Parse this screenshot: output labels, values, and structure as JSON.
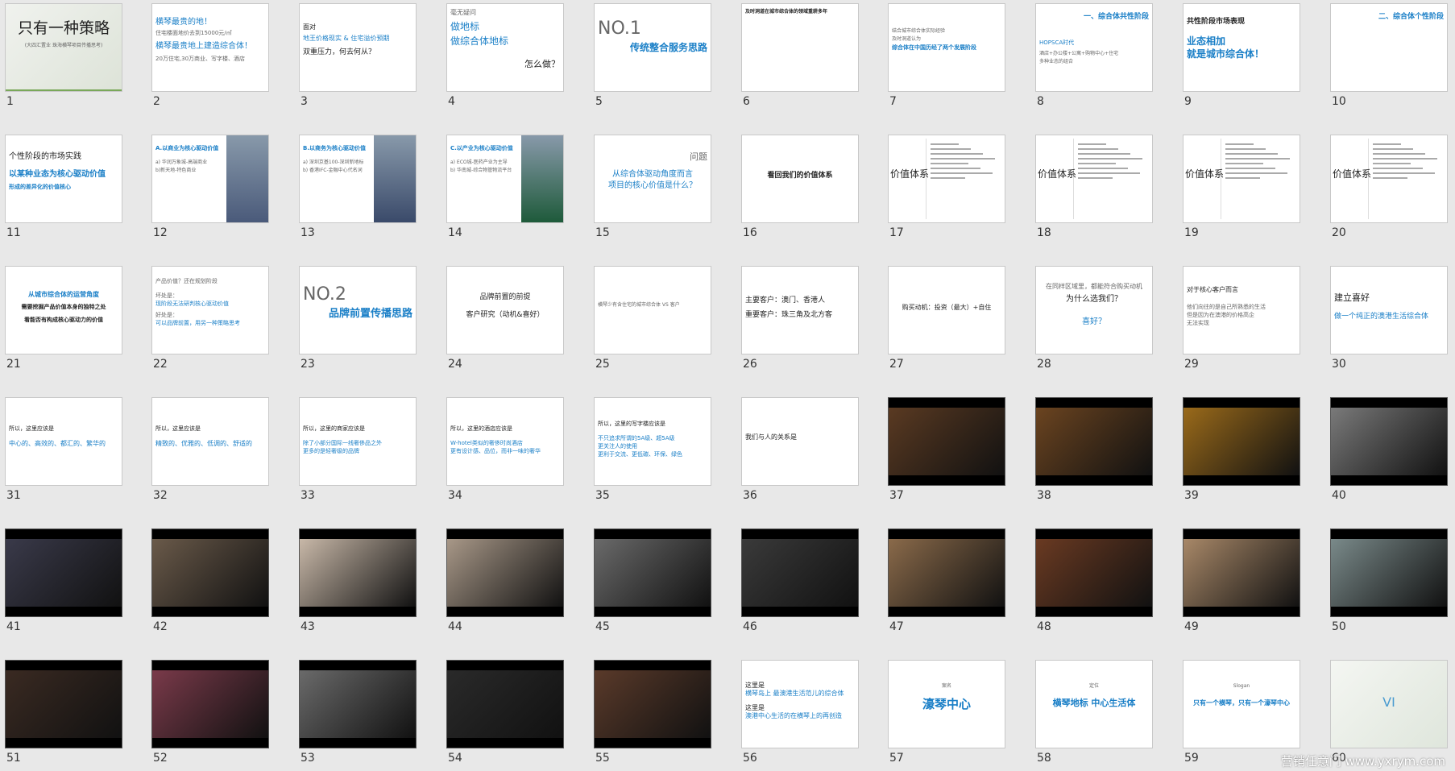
{
  "colors": {
    "accent": "#1a7fc7",
    "background": "#e8e8e8"
  },
  "slides": [
    {
      "n": "1",
      "kind": "title",
      "lines": [
        "只有一种策略",
        "(大四汇置业 珠海横琴项目传播思考)"
      ]
    },
    {
      "n": "2",
      "kind": "text",
      "lines": [
        "横琴最贵的地！",
        "住宅楼面地价去到15000元/㎡",
        "横琴最贵地上建造综合体！",
        "20万住宅,30万商业、写字楼、酒店"
      ]
    },
    {
      "n": "3",
      "kind": "text",
      "lines": [
        "面对",
        "地王价格现实 & 住宅溢价预期",
        "双重压力，何去何从？"
      ]
    },
    {
      "n": "4",
      "kind": "text",
      "lines": [
        "毫无疑问",
        "做地标",
        "做综合体地标",
        "怎么做？"
      ]
    },
    {
      "n": "5",
      "kind": "text",
      "lines": [
        "NO.1",
        "传统整合服务思路"
      ]
    },
    {
      "n": "6",
      "kind": "text",
      "lines": [
        "及时洞道在城市综合体的领域重耕多年"
      ]
    },
    {
      "n": "7",
      "kind": "text",
      "lines": [
        "结合城市综合体实际经验",
        "及时洞道认为",
        "综合体在中国历经了两个发展阶段"
      ]
    },
    {
      "n": "8",
      "kind": "text",
      "lines": [
        "一、综合体共性阶段",
        "HOPSCA时代",
        "酒店+办公楼+公寓+购物中心+住宅",
        "多种业态的组合"
      ]
    },
    {
      "n": "9",
      "kind": "text",
      "lines": [
        "共性阶段市场表现",
        "业态相加",
        "就是城市综合体！"
      ]
    },
    {
      "n": "10",
      "kind": "text",
      "lines": [
        "二、综合体个性阶段"
      ]
    },
    {
      "n": "11",
      "kind": "text",
      "lines": [
        "个性阶段的市场实践",
        "以某种业态为核心驱动价值",
        "形成的差异化的价值核心"
      ]
    },
    {
      "n": "12",
      "kind": "side",
      "lines": [
        "A.以商业为核心驱动价值",
        "a) 华润万象城-高端商业",
        "b)新天地-特色商业"
      ]
    },
    {
      "n": "13",
      "kind": "side",
      "lines": [
        "B.以商务为核心驱动价值",
        "a) 深圳京基100-深圳新地标",
        "b) 香港IFC-金融中心代名词"
      ]
    },
    {
      "n": "14",
      "kind": "side",
      "lines": [
        "C.以产业为核心驱动价值",
        "a) ECO城-医药产业为主导",
        "b) 华南城-综合物管物流平台"
      ]
    },
    {
      "n": "15",
      "kind": "text",
      "lines": [
        "问题",
        "从综合体驱动角度而言",
        "项目的核心价值是什么？"
      ]
    },
    {
      "n": "16",
      "kind": "text",
      "lines": [
        "看回我们的价值体系"
      ]
    },
    {
      "n": "17",
      "kind": "value",
      "lines": [
        "价值体系"
      ]
    },
    {
      "n": "18",
      "kind": "value",
      "lines": [
        "价值体系"
      ]
    },
    {
      "n": "19",
      "kind": "value",
      "lines": [
        "价值体系"
      ]
    },
    {
      "n": "20",
      "kind": "value",
      "lines": [
        "价值体系"
      ]
    },
    {
      "n": "21",
      "kind": "text",
      "lines": [
        "从城市综合体的运营角度",
        "需要挖掘产品价值本身的独特之处",
        "看能否有构成核心驱动力的价值"
      ]
    },
    {
      "n": "22",
      "kind": "text",
      "lines": [
        "产品价值？还在规划阶段",
        "坏处是：",
        "现阶段无法研判核心驱动价值",
        "好处是：",
        "可以品牌前置，用另一种策略思考"
      ]
    },
    {
      "n": "23",
      "kind": "text",
      "lines": [
        "NO.2",
        "品牌前置传播思路"
      ]
    },
    {
      "n": "24",
      "kind": "text",
      "lines": [
        "品牌前置的前提",
        "客户研究（动机&喜好）"
      ]
    },
    {
      "n": "25",
      "kind": "text",
      "lines": [
        "横琴少有含住宅的城市综合体  VS  客户"
      ]
    },
    {
      "n": "26",
      "kind": "text",
      "lines": [
        "主要客户：澳门、香港人",
        "重要客户：珠三角及北方客"
      ]
    },
    {
      "n": "27",
      "kind": "text",
      "lines": [
        "购买动机：投资（最大）+自住"
      ]
    },
    {
      "n": "28",
      "kind": "text",
      "lines": [
        "在同样区域里，都能符合购买动机",
        "为什么选我们？",
        "喜好？"
      ]
    },
    {
      "n": "29",
      "kind": "text",
      "lines": [
        "对于核心客户而言",
        "他们向往的是自己所熟悉的生活",
        "但是因为在澳港的价格高企",
        "无法实现"
      ]
    },
    {
      "n": "30",
      "kind": "text",
      "lines": [
        "建立喜好",
        "做一个纯正的澳港生活综合体"
      ]
    },
    {
      "n": "31",
      "kind": "text",
      "lines": [
        "所以，这里应该是",
        "中心的、高效的、都汇的、繁华的"
      ]
    },
    {
      "n": "32",
      "kind": "text",
      "lines": [
        "所以，这里应该是",
        "精致的、优雅的、低调的、舒适的"
      ]
    },
    {
      "n": "33",
      "kind": "text",
      "lines": [
        "所以，这里的商家应该是",
        "除了小部分国际一线奢侈品之外",
        "更多的是轻奢级的品牌"
      ]
    },
    {
      "n": "34",
      "kind": "text",
      "lines": [
        "所以，这里的酒店应该是",
        "W-hotel类似的奢侈时尚酒店",
        "更有设计感、品位，而非一味的奢华"
      ]
    },
    {
      "n": "35",
      "kind": "text",
      "lines": [
        "所以，这里的写字楼应该是",
        "不只追求所谓的5A级、超5A级",
        "更关注人的使用",
        "更利于交流、更低碳、环保、绿色"
      ]
    },
    {
      "n": "36",
      "kind": "text",
      "lines": [
        "我们与人的关系是"
      ]
    },
    {
      "n": "37",
      "kind": "photo",
      "tone": "#5a3a22"
    },
    {
      "n": "38",
      "kind": "photo",
      "tone": "#6b4420"
    },
    {
      "n": "39",
      "kind": "photo",
      "tone": "#9a6a1a"
    },
    {
      "n": "40",
      "kind": "photo",
      "tone": "#7a7a7a"
    },
    {
      "n": "41",
      "kind": "photo",
      "tone": "#3a3a4a"
    },
    {
      "n": "42",
      "kind": "photo",
      "tone": "#6a5a4a"
    },
    {
      "n": "43",
      "kind": "photo",
      "tone": "#c8b8a8"
    },
    {
      "n": "44",
      "kind": "photo",
      "tone": "#a89888"
    },
    {
      "n": "45",
      "kind": "photo",
      "tone": "#6a6a6a"
    },
    {
      "n": "46",
      "kind": "photo",
      "tone": "#3a3a3a"
    },
    {
      "n": "47",
      "kind": "photo",
      "tone": "#8a6a4a"
    },
    {
      "n": "48",
      "kind": "photo",
      "tone": "#6a3a22"
    },
    {
      "n": "49",
      "kind": "photo",
      "tone": "#a88868"
    },
    {
      "n": "50",
      "kind": "photo",
      "tone": "#7a8a8a"
    },
    {
      "n": "51",
      "kind": "photo",
      "tone": "#3a2a22"
    },
    {
      "n": "52",
      "kind": "photo",
      "tone": "#7a3a4a"
    },
    {
      "n": "53",
      "kind": "photo",
      "tone": "#6a6a6a"
    },
    {
      "n": "54",
      "kind": "photo",
      "tone": "#2a2a2a"
    },
    {
      "n": "55",
      "kind": "photo",
      "tone": "#5a3a2a"
    },
    {
      "n": "56",
      "kind": "text",
      "lines": [
        "这里是",
        "横琴岛上  最澳港生活范儿的综合体",
        "这里是",
        "澳港中心生活的在横琴上的再创造"
      ]
    },
    {
      "n": "57",
      "kind": "text",
      "lines": [
        "案名",
        "濠琴中心"
      ]
    },
    {
      "n": "58",
      "kind": "text",
      "lines": [
        "定位",
        "横琴地标  中心生活体"
      ]
    },
    {
      "n": "59",
      "kind": "text",
      "lines": [
        "Slogan",
        "只有一个横琴，只有一个濠琴中心"
      ]
    },
    {
      "n": "60",
      "kind": "vi",
      "lines": [
        "VI"
      ]
    }
  ],
  "watermark": "营销任意门 www.yxrym.com"
}
